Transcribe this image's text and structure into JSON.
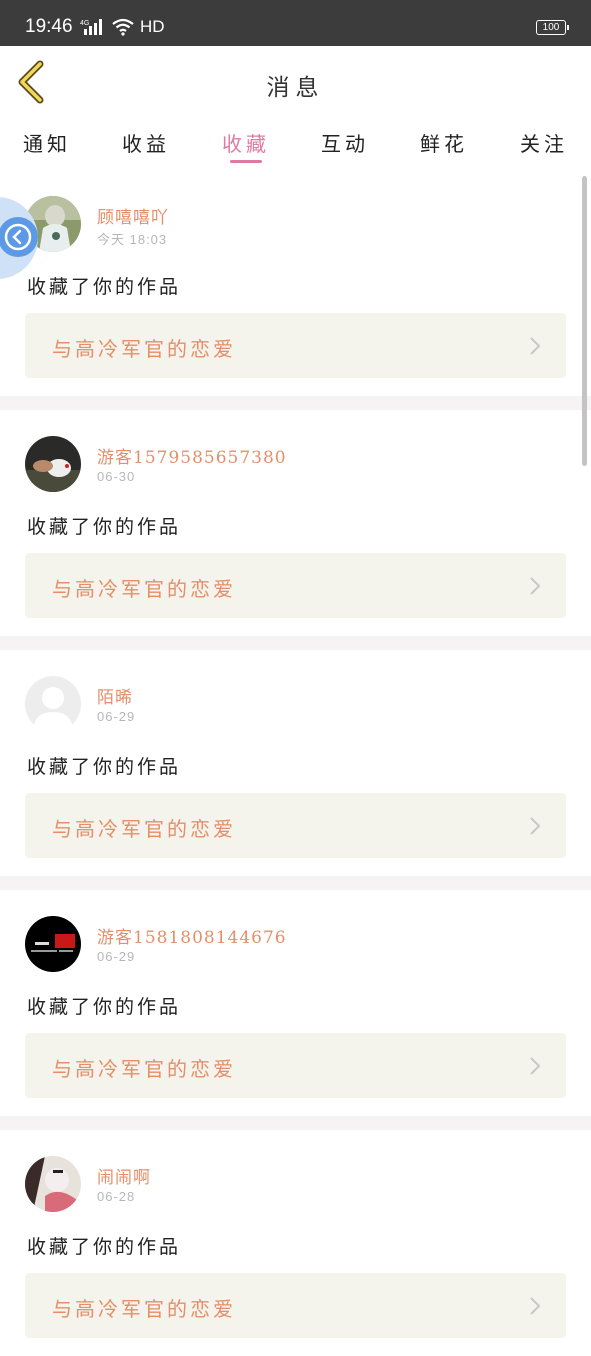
{
  "status_bar": {
    "time": "19:46",
    "network": "4G",
    "hd": "HD",
    "battery": "100"
  },
  "header": {
    "title": "消息"
  },
  "tabs": [
    {
      "label": "通知"
    },
    {
      "label": "收益"
    },
    {
      "label": "收藏"
    },
    {
      "label": "互动"
    },
    {
      "label": "鲜花"
    },
    {
      "label": "关注"
    }
  ],
  "active_tab": "收藏",
  "colors": {
    "accent_pink": "#e07aa3",
    "name_orange": "#e58e69",
    "work_box_bg": "#f5f4ec"
  },
  "items": [
    {
      "user": "顾嘻嘻吖",
      "time": "今天 18:03",
      "action": "收藏了你的作品",
      "work": "与高冷军官的恋爱"
    },
    {
      "user": "游客1579585657380",
      "time": "06-30",
      "action": "收藏了你的作品",
      "work": "与高冷军官的恋爱"
    },
    {
      "user": "陌晞",
      "time": "06-29",
      "action": "收藏了你的作品",
      "work": "与高冷军官的恋爱"
    },
    {
      "user": "游客1581808144676",
      "time": "06-29",
      "action": "收藏了你的作品",
      "work": "与高冷军官的恋爱"
    },
    {
      "user": "闹闹啊",
      "time": "06-28",
      "action": "收藏了你的作品",
      "work": "与高冷军官的恋爱"
    }
  ]
}
